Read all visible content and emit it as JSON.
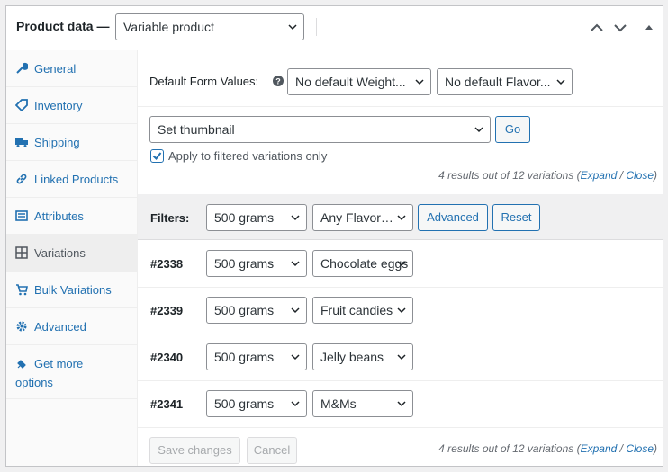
{
  "header": {
    "title": "Product data —",
    "product_type": "Variable product"
  },
  "sidebar": {
    "items": [
      {
        "label": "General",
        "icon": "wrench-icon"
      },
      {
        "label": "Inventory",
        "icon": "tag-icon"
      },
      {
        "label": "Shipping",
        "icon": "truck-icon"
      },
      {
        "label": "Linked Products",
        "icon": "link-icon"
      },
      {
        "label": "Attributes",
        "icon": "list-icon"
      },
      {
        "label": "Variations",
        "icon": "grid-icon"
      },
      {
        "label": "Bulk Variations",
        "icon": "cart-icon"
      },
      {
        "label": "Advanced",
        "icon": "gear-icon"
      },
      {
        "label": "Get more",
        "label2": "options",
        "icon": "plugin-icon"
      }
    ]
  },
  "defaults": {
    "label": "Default Form Values:",
    "weight": "No default Weight...",
    "flavor": "No default Flavor..."
  },
  "bulk": {
    "action": "Set thumbnail",
    "go": "Go",
    "apply_label": "Apply to filtered variations only",
    "apply_checked": true
  },
  "summary": {
    "text": "4 results out of 12 variations (",
    "expand": "Expand",
    "slash": " / ",
    "close": "Close",
    "end": ")"
  },
  "filters": {
    "label": "Filters:",
    "weight": "500 grams",
    "flavor": "Any Flavor…",
    "advanced": "Advanced",
    "reset": "Reset"
  },
  "variations": [
    {
      "id": "#2338",
      "weight": "500 grams",
      "flavor": "Chocolate eggs"
    },
    {
      "id": "#2339",
      "weight": "500 grams",
      "flavor": "Fruit candies"
    },
    {
      "id": "#2340",
      "weight": "500 grams",
      "flavor": "Jelly beans"
    },
    {
      "id": "#2341",
      "weight": "500 grams",
      "flavor": "M&Ms"
    }
  ],
  "footer": {
    "save": "Save changes",
    "cancel": "Cancel"
  },
  "colors": {
    "accent": "#2271b1",
    "filter_bg": "#f0f0f1"
  }
}
